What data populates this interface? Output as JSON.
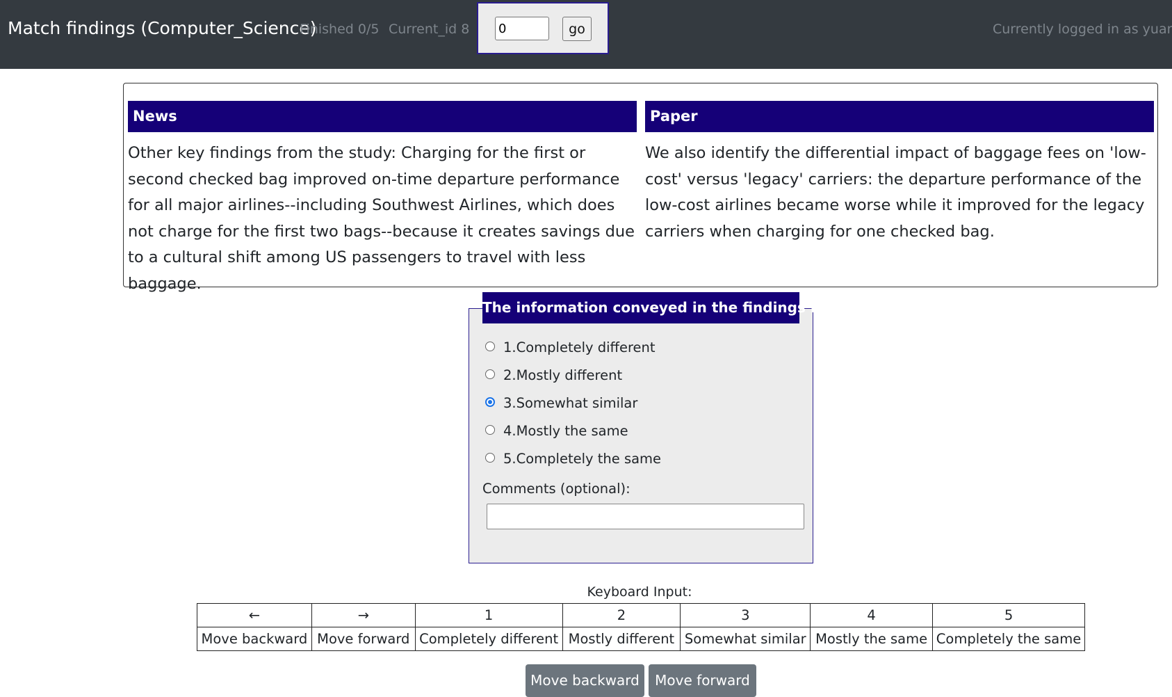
{
  "navbar": {
    "brand": "Match findings (Computer_Science)",
    "finished": "Finished 0/5",
    "current_id": "Current_id 8",
    "goto_value": "0",
    "goto_button": "go",
    "user": "Currently logged in as yuanyu"
  },
  "findings": {
    "news_header": "News",
    "news_text": "Other key findings from the study: Charging for the first or second checked bag improved on-time departure performance for all major airlines--including Southwest Airlines, which does not charge for the first two bags--because it creates savings due to a cultural shift among US passengers to travel with less baggage.",
    "paper_header": "Paper",
    "paper_text": "We also identify the differential impact of baggage fees on 'low-cost' versus 'legacy' carriers: the departure performance of the low-cost airlines became worse while it improved for the legacy carriers when charging for one checked bag."
  },
  "rating": {
    "legend": "The information conveyed in the findings is",
    "options": [
      {
        "label": "1.Completely different",
        "checked": false
      },
      {
        "label": "2.Mostly different",
        "checked": false
      },
      {
        "label": "3.Somewhat similar",
        "checked": true
      },
      {
        "label": "4.Mostly the same",
        "checked": false
      },
      {
        "label": "5.Completely the same",
        "checked": false
      }
    ],
    "comments_label": "Comments (optional):",
    "comments_value": ""
  },
  "keyboard": {
    "title": "Keyboard Input:",
    "keys": [
      "←",
      "→",
      "1",
      "2",
      "3",
      "4",
      "5"
    ],
    "actions": [
      "Move backward",
      "Move forward",
      "Completely different",
      "Mostly different",
      "Somewhat similar",
      "Mostly the same",
      "Completely the same"
    ]
  },
  "buttons": {
    "back": "Move backward",
    "forward": "Move forward"
  },
  "colors": {
    "navbar": "#343a40",
    "header_bg": "#150078",
    "button_bg": "#6c757d",
    "radio_accent": "#1a73e8"
  }
}
